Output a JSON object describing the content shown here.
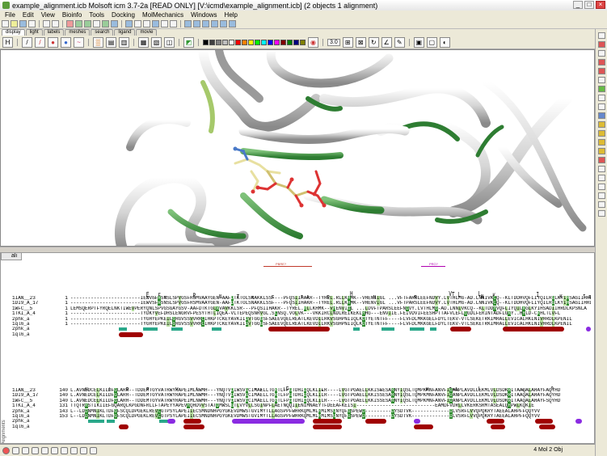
{
  "window": {
    "title": "example_alignment.icb Molsoft icm 3.7-2a [READ ONLY] [V:\\icmd\\example_alignment.icb] (2 objects 1 alignment)"
  },
  "menu": [
    "File",
    "Edit",
    "View",
    "Bioinfo",
    "Tools",
    "Docking",
    "MolMechanics",
    "Windows",
    "Help"
  ],
  "tabs": [
    "display",
    "light",
    "labels",
    "meshes",
    "search",
    "ligand",
    "movie"
  ],
  "active_tab": "display",
  "swatch_colors": [
    "#000000",
    "#404040",
    "#808080",
    "#c0c0c0",
    "#ffffff",
    "#ff0000",
    "#ff8000",
    "#ffff00",
    "#00ff00",
    "#00ffff",
    "#0000ff",
    "#ff00ff",
    "#800000",
    "#008000",
    "#000080",
    "#808000"
  ],
  "toolbar2_zoom": "3.0",
  "alignment": {
    "tab_label": "ali",
    "side_label": "Alignments",
    "block1": {
      "annotations": [
        {
          "label": "PBRE?",
          "color": "#c0392b"
        },
        {
          "label": "PRO?",
          "color": "#b000b0"
        }
      ],
      "rows": [
        {
          "name": "1IAN__23",
          "num": "1",
          "seq": "------------------------IEWVSFRSNSLSPVGSFRSMVAAYGEN-AAFDTKTOLSNAKKLSSF---PFQSIIHAKR--TYREL.RLLKHMK--VHENIIGL ...VFTFARSLEEFNDVY.LVTHLMG-AD.LNNIVKCQ--KLTDDHVQFLIYQILRGLKYIHSAGIIHRDLKPSNLA"
        },
        {
          "name": "1DI9_A_17",
          "num": "1",
          "seq": "------------------------IEWVSFRSNSLSPVGSFRSMVAAYGEN-AAFDTKTOLSNAKKLSSF---PFQSIIHAKR--TYREL.RLLKHMK--VHENVIGL ...VFTPARSLEEFNDVY.LVTHLMG-AD.LNNIVKCQ--KLTDDHVQFLIYQILRGLKYIHSAGIIHRDLKPSNLA"
        },
        {
          "name": "1WFC__5",
          "num": "1",
          "seq": "LEMSQERPTFYRQELNKTIWEVPERYQNLSPVGSGAYGSV-AAFDTKTGLRVAVKKLSR---PFQSIIHAKR--TYREL.RLLKHMK--VHENVIGL ...LDVFTPARSLEEFNDVY.LVTHLMG-AD.LNNIVKCQ--KLTDDHVQFLIYQILRGLKYIHSADIIHRDLKPSNLA"
        },
        {
          "name": "1TKI_A_4",
          "num": "1",
          "seq": "------------------------TYDKYVEFDHSLENGRVFPESYTHTLIQEA-VLTEPEQSNRVGL.SCNSQ.VOLVK---VKKIRCLNDLREIKEKLHHG---ENVIIE.FEIVDVIFEESHPTTAFVLEFLGGDLFERINTADFLGRY..HHLD-CRHLTLVFL"
        },
        {
          "name": "2phk_a",
          "num": "1",
          "seq": "------------------------TYGHYEPKEILGRGVSSVVRRCIHKPTCKEYAVKIIDVTGGGSFSAEEVQELREATLKEVDILRKVSGHPNIIQLKDTYETNTFF----FLVFDLMKKGELFDYLTEKV-VTLSEKETRKIMRALLEVICALHKLNIVHRDLKPENIL"
        },
        {
          "name": "1ql6_a",
          "num": "1",
          "seq": "------------------------TYGHYEPKEILGRGVSSVVRRCIHKPTCKEYAVKIIDVTGGGSFSAEEVQELREATLKEVDILRKVSGHPNIIQLKDTYETNTFF----FLVFDLMKKGELFDYLTEKV-VTLSEKETRKIMRALLEVICALHKLNIVHRDLKPENIL"
        },
        {
          "name": "2phk_a",
          "num": "",
          "seq": ""
        },
        {
          "name": "1ql6_a",
          "num": "",
          "seq": ""
        }
      ]
    },
    "block2": {
      "rows": [
        {
          "name": "1IAN__23",
          "num": "140",
          "seq": "L.AVNEDCELKILDFGLARH--TDDEMTGYVATRWYRAPEIMLNWMH---YNQTVDIWSVGCIMAELLTGRTLFPGTDHIDQLKLILR----LVGTPGAELLKKISSESARNYIQSLTQMPKMNFANVFIGANPLAVDLLEKMLVLDSDKRITAAQALAHAYFAQYHD"
        },
        {
          "name": "1DI9_A_17",
          "num": "140",
          "seq": "L.AVNEDCELKILDFGLARH--TDDEMTGYVATRWYRAPEIMLNWMH---YNQTVDIWSVGCIMAELLTGRTLFPGTDHIDQLKLILR----LVGTPGAELLKKISSESARNYIQSLTQMPKMNFANVFIGANPLAVDLLEKMLVLDSDKRITAAQALAHAYFAQYHD"
        },
        {
          "name": "1WFC__5",
          "num": "140",
          "seq": "L.AVNEDCELKILDFGLARH--TDDEMTGYVATRWYRAPEIMLNWMH---YNQTVDIWSVGCIMAELLTGRTLFPGTDHIDQLKLILR----LVGTPGAELLKKISSESARNYIQSLTQMPKMNFANVFIGANPLAVDLLEKMLVLDSDKRITAAQALAHAYFSQYHD"
        },
        {
          "name": "1TKI_A_4",
          "num": "131",
          "seq": "TTQTRRSTIKIIEFGQARQLKPGDNFRLLFTAPEYYAPEVHQHDVVSTATDMWSLGTLVYVLLSGINPFLAETNQQIIENIMNAEYTFDEEAFKEISI---------------------------EAMDFVDRLLVKERKSRMTASEALQHPWLKQKIE"
        },
        {
          "name": "2phk_a",
          "num": "143",
          "seq": "L--LDDNMNIKLTDFGFSCQLDPGEKLREVCGTPSYLAPEIIECSMNDNHPGYGKEVDMWSTGVIMYTLLAGSPPFWHRKQMLMLRMIMSGNYQFGSPEWD---------DYSDTVK-------------DLVSRFLVVQPQKRYTAEEALAHPFFQQYVV"
        },
        {
          "name": "1ql6_a",
          "num": "153",
          "seq": "L--LDDNMNIKLTDFGFSCQLDPGEKLREVCGTPSYLAPEIIECSMNDNHPGYGKEVDMWSTGVIMYTLLAGSPPFWHRKQMLMLRMIMSGNYQFGSPEWD---------DYSDTVK-------------DLVSRFLVVQPQKRYTAEEALAHPFFQQYVV"
        },
        {
          "name": "2phk_a",
          "num": "",
          "seq": ""
        },
        {
          "name": "1ql6_a",
          "num": "",
          "seq": ""
        }
      ]
    }
  },
  "status": {
    "text": "4 Mol 2 Obj"
  }
}
